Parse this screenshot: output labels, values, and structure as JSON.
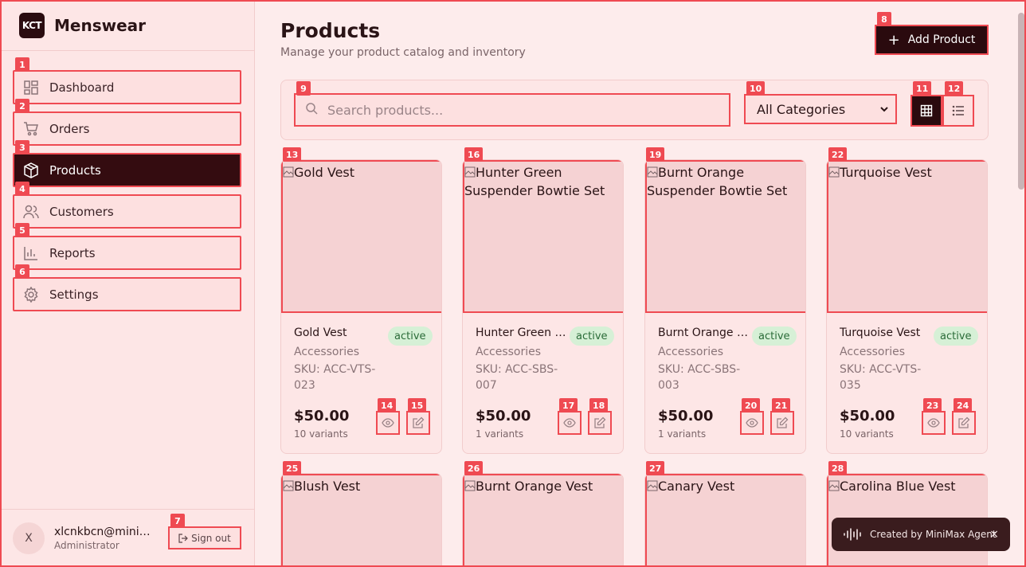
{
  "brand": {
    "logo": "KCT",
    "name": "Menswear"
  },
  "nav": [
    {
      "label": "Dashboard",
      "icon": "dashboard-icon",
      "marker": "1"
    },
    {
      "label": "Orders",
      "icon": "cart-icon",
      "marker": "2"
    },
    {
      "label": "Products",
      "icon": "box-icon",
      "marker": "3",
      "active": true
    },
    {
      "label": "Customers",
      "icon": "users-icon",
      "marker": "4"
    },
    {
      "label": "Reports",
      "icon": "chart-icon",
      "marker": "5"
    },
    {
      "label": "Settings",
      "icon": "gear-icon",
      "marker": "6"
    }
  ],
  "user": {
    "initial": "X",
    "email": "xlcnkbcn@minimax.io",
    "role": "Administrator",
    "signout_label": "Sign out",
    "signout_marker": "7"
  },
  "header": {
    "title": "Products",
    "subtitle": "Manage your product catalog and inventory",
    "add_label": "Add Product",
    "add_marker": "8"
  },
  "toolbar": {
    "search_placeholder": "Search products...",
    "search_marker": "9",
    "category_selected": "All Categories",
    "category_marker": "10",
    "grid_marker": "11",
    "list_marker": "12"
  },
  "products": [
    {
      "name": "Gold Vest",
      "status": "active",
      "category": "Accessories",
      "sku": "SKU: ACC-VTS-023",
      "price": "$50.00",
      "variants": "10 variants",
      "img_alt": "Gold Vest",
      "markers": [
        "13",
        "14",
        "15"
      ]
    },
    {
      "name": "Hunter Green Suspender Bowtie Set",
      "status": "active",
      "category": "Accessories",
      "sku": "SKU: ACC-SBS-007",
      "price": "$50.00",
      "variants": "1 variants",
      "img_alt": "Hunter Green Suspender Bowtie Set",
      "markers": [
        "16",
        "17",
        "18"
      ]
    },
    {
      "name": "Burnt Orange Suspender Bowtie Set",
      "status": "active",
      "category": "Accessories",
      "sku": "SKU: ACC-SBS-003",
      "price": "$50.00",
      "variants": "1 variants",
      "img_alt": "Burnt Orange Suspender Bowtie Set",
      "markers": [
        "19",
        "20",
        "21"
      ]
    },
    {
      "name": "Turquoise Vest",
      "status": "active",
      "category": "Accessories",
      "sku": "SKU: ACC-VTS-035",
      "price": "$50.00",
      "variants": "10 variants",
      "img_alt": "Turquoise Vest",
      "markers": [
        "22",
        "23",
        "24"
      ]
    },
    {
      "img_alt": "Blush Vest",
      "markers": [
        "25"
      ]
    },
    {
      "img_alt": "Burnt Orange Vest",
      "markers": [
        "26"
      ]
    },
    {
      "img_alt": "Canary Vest",
      "markers": [
        "27"
      ]
    },
    {
      "img_alt": "Carolina Blue Vest",
      "markers": [
        "28"
      ]
    }
  ],
  "toast": {
    "text": "Created by MiniMax Agent",
    "close": "×"
  }
}
